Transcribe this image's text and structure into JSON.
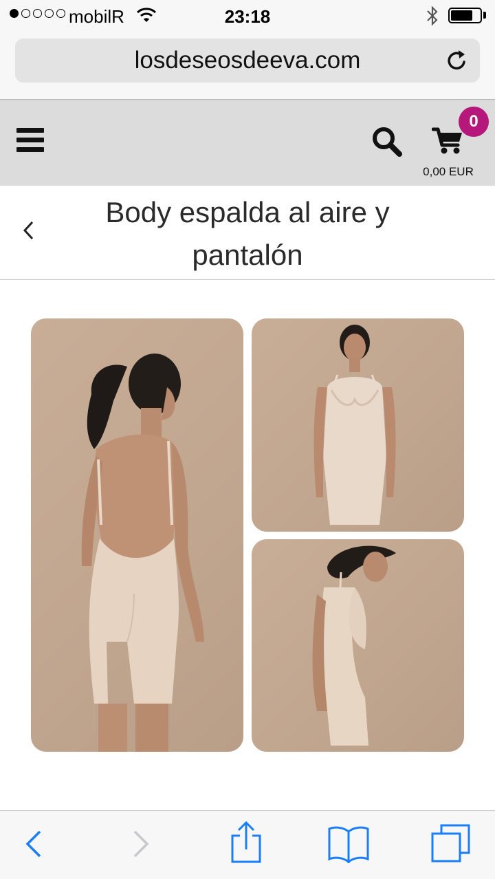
{
  "status_bar": {
    "carrier": "mobilR",
    "time": "23:18",
    "signal_bars_filled": 1,
    "signal_bars_total": 5,
    "battery_level": 0.75
  },
  "browser": {
    "url": "losdeseosdeeva.com",
    "reload_icon": "reload-icon"
  },
  "header": {
    "menu_icon": "hamburger-menu-icon",
    "search_icon": "search-icon",
    "cart_icon": "shopping-cart-icon",
    "cart_count": "0",
    "cart_total": "0,00 EUR",
    "badge_color": "#b5177b"
  },
  "product": {
    "title": "Body espalda al aire y pantalón",
    "back_icon": "chevron-left-icon",
    "images": [
      {
        "name": "back-view"
      },
      {
        "name": "front-view"
      },
      {
        "name": "side-view"
      }
    ]
  },
  "toolbar": {
    "items": [
      "back-icon",
      "forward-icon",
      "share-icon",
      "bookmarks-icon",
      "tabs-icon"
    ],
    "accent": "#1a7ef7",
    "disabled": "#c7c7cc"
  }
}
